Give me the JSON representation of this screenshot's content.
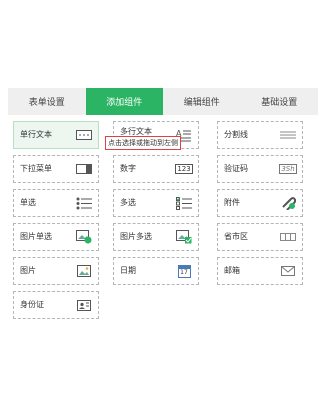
{
  "tabs": [
    {
      "label": "表单设置"
    },
    {
      "label": "添加组件"
    },
    {
      "label": "编辑组件"
    },
    {
      "label": "基础设置"
    }
  ],
  "components": {
    "single_text": "单行文本",
    "multi_text": "多行文本",
    "divider": "分割线",
    "dropdown": "下拉菜单",
    "number": "数字",
    "captcha": "验证码",
    "radio": "单选",
    "checkbox": "多选",
    "attachment": "附件",
    "image_radio": "图片单选",
    "image_checkbox": "图片多选",
    "region": "省市区",
    "image": "图片",
    "date": "日期",
    "email": "邮箱",
    "id_card": "身份证"
  },
  "icon_text": {
    "number": "123",
    "captcha": "3Sh",
    "date": "17",
    "multi_text": "A≡"
  },
  "tooltip": "点击选择或拖动到左侧",
  "colors": {
    "accent": "#2bb464",
    "tooltip_border": "#e04040"
  }
}
